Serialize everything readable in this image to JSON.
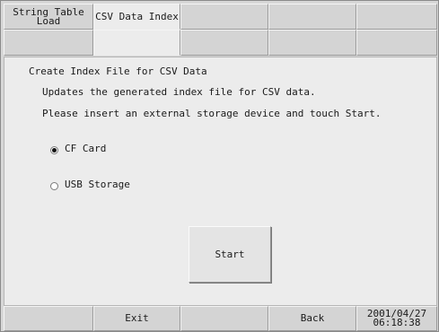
{
  "tabs": [
    {
      "label": "String Table\nLoad"
    },
    {
      "label": "CSV Data Index"
    },
    {
      "label": ""
    },
    {
      "label": ""
    },
    {
      "label": ""
    }
  ],
  "panel": {
    "title": "Create Index File for CSV Data",
    "line1": "Updates the generated index file for CSV data.",
    "line2": "Please insert an external storage device and touch Start.",
    "options": [
      {
        "label": "CF Card",
        "selected": true
      },
      {
        "label": "USB Storage",
        "selected": false
      }
    ],
    "start_label": "Start"
  },
  "footer": {
    "exit_label": "Exit",
    "back_label": "Back",
    "datetime": "2001/04/27\n06:18:38"
  }
}
